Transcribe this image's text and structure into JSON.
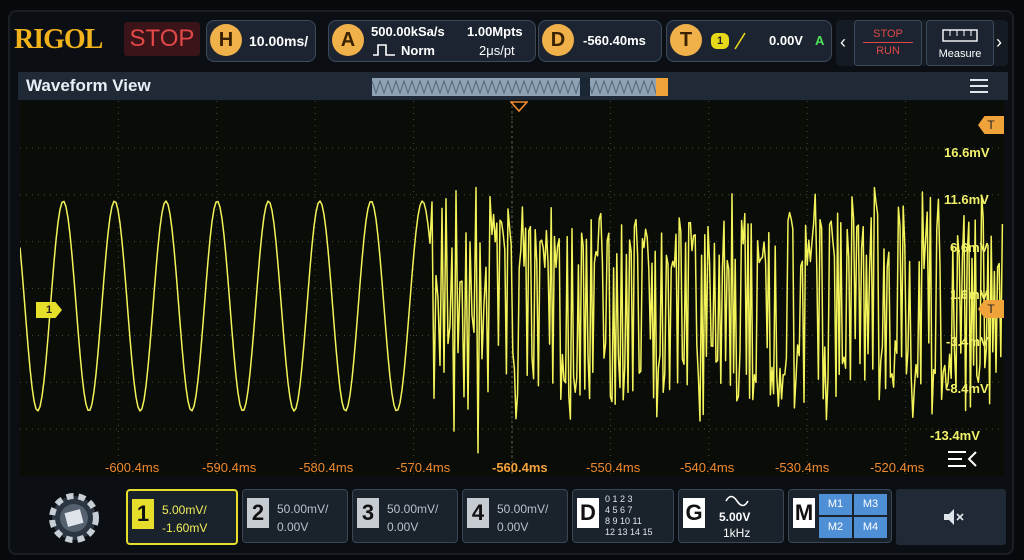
{
  "brand": "RIGOL",
  "run_state": "STOP",
  "horizontal": {
    "key": "H",
    "timebase": "10.00ms/"
  },
  "acquire": {
    "key": "A",
    "sample_rate": "500.00kSa/s",
    "memory_depth": "1.00Mpts",
    "mode": "Norm",
    "sample_interval": "2μs/pt"
  },
  "delay": {
    "key": "D",
    "offset": "-560.40ms"
  },
  "trigger": {
    "key": "T",
    "source_badge": "1",
    "slope_icon": "rising-edge-icon",
    "level": "0.00V",
    "status": "A"
  },
  "stop_run": {
    "top": "STOP",
    "bottom": "RUN"
  },
  "measure_label": "Measure",
  "waveform_view_title": "Waveform View",
  "trigger_marker": "T",
  "channel_marker": "1",
  "voltage_labels": [
    "16.6mV",
    "11.6mV",
    "6.6mV",
    "1.6mV",
    "-3.4mV",
    "-8.4mV",
    "-13.4mV"
  ],
  "time_labels": [
    "-600.4ms",
    "-590.4ms",
    "-580.4ms",
    "-570.4ms",
    "-560.4ms",
    "-550.4ms",
    "-540.4ms",
    "-530.4ms",
    "-520.4ms"
  ],
  "channels": [
    {
      "num": "1",
      "scale": "5.00mV/",
      "offset": "-1.60mV",
      "active": true
    },
    {
      "num": "2",
      "scale": "50.00mV/",
      "offset": "0.00V",
      "active": false
    },
    {
      "num": "3",
      "scale": "50.00mV/",
      "offset": "0.00V",
      "active": false
    },
    {
      "num": "4",
      "scale": "50.00mV/",
      "offset": "0.00V",
      "active": false
    }
  ],
  "digital": {
    "key": "D",
    "rows": [
      "0  1  2  3",
      "4  5  6  7",
      "8  9  10  11",
      "12  13  14  15"
    ]
  },
  "generator": {
    "key": "G",
    "amplitude": "5.00V",
    "frequency": "1kHz"
  },
  "math": {
    "key": "M",
    "items": [
      "M1",
      "M3",
      "M2",
      "M4"
    ]
  },
  "colors": {
    "trace": "#f3f35a",
    "accent": "#f0b04a",
    "time_label": "#f08a2e",
    "stop": "#e24848"
  }
}
